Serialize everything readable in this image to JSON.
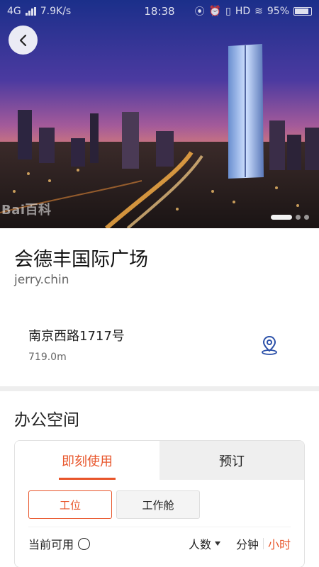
{
  "status_bar": {
    "network": "4G",
    "speed": "7.9K/s",
    "time": "18:38",
    "hd": "HD",
    "battery": "95%"
  },
  "hero": {
    "watermark": "Bai百科",
    "slides_total": 3,
    "active_slide": 1
  },
  "building": {
    "name": "会德丰国际广场",
    "owner": "jerry.chin",
    "address": "南京西路1717号",
    "distance": "719.0m"
  },
  "section": {
    "title": "办公空间"
  },
  "tabs": [
    {
      "label": "即刻使用",
      "active": true
    },
    {
      "label": "预订",
      "active": false
    }
  ],
  "types": [
    {
      "label": "工位",
      "active": true
    },
    {
      "label": "工作舱",
      "active": false
    }
  ],
  "filters": {
    "available_now": "当前可用",
    "people": "人数",
    "minute": "分钟",
    "hour": "小时"
  },
  "colors": {
    "accent": "#e8552a",
    "location_icon": "#2a4fa8"
  }
}
